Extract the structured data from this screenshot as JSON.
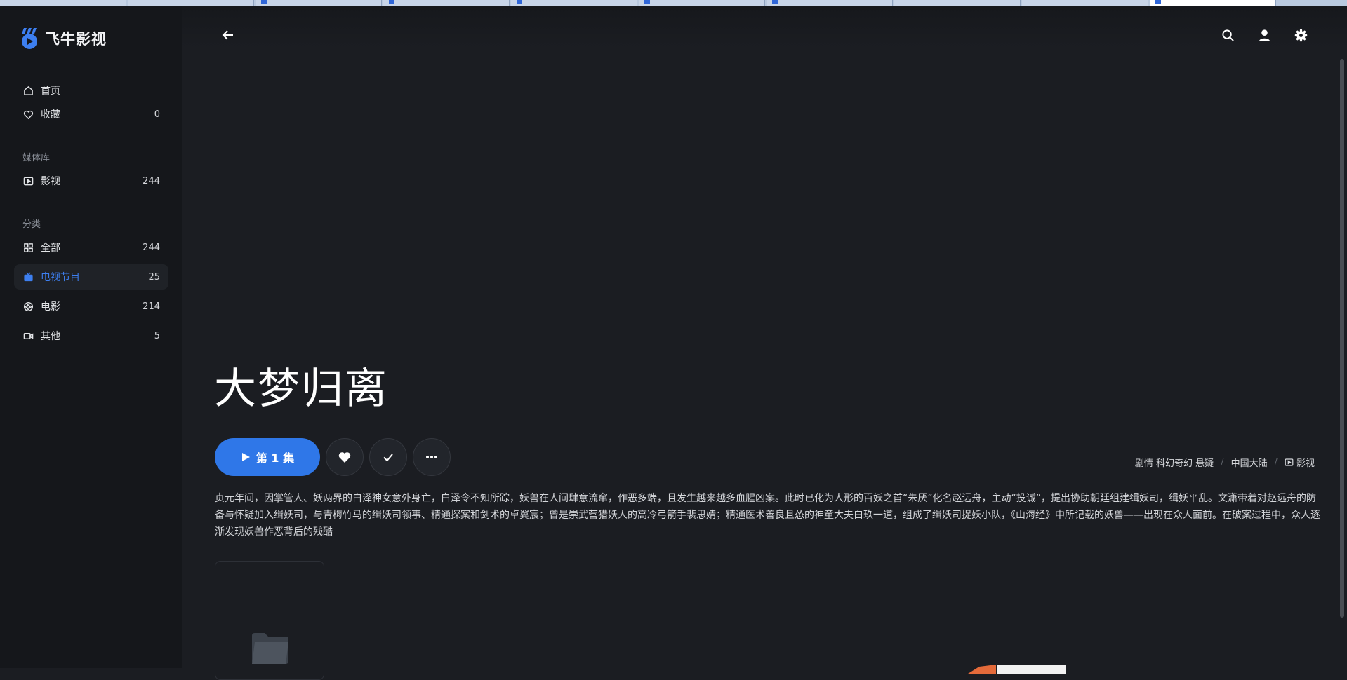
{
  "app": {
    "name": "飞牛影视",
    "accent": "#2f77e8"
  },
  "sidebar": {
    "top_items": [
      {
        "label": "首页",
        "count": "",
        "icon": "home-icon"
      },
      {
        "label": "收藏",
        "count": "0",
        "icon": "heart-icon"
      }
    ],
    "library_title": "媒体库",
    "library_items": [
      {
        "label": "影视",
        "count": "244",
        "icon": "play-square-icon"
      }
    ],
    "category_title": "分类",
    "category_items": [
      {
        "label": "全部",
        "count": "244",
        "icon": "grid-icon"
      },
      {
        "label": "电视节目",
        "count": "25",
        "icon": "tv-icon",
        "active": true
      },
      {
        "label": "电影",
        "count": "214",
        "icon": "film-reel-icon"
      },
      {
        "label": "其他",
        "count": "5",
        "icon": "video-camera-icon"
      }
    ]
  },
  "detail": {
    "title": "大梦归离",
    "play_label": "第 1 集",
    "meta": {
      "genres": "剧情 科幻奇幻 悬疑",
      "region": "中国大陆",
      "library": "影视"
    },
    "description": "贞元年间，因掌管人、妖两界的白泽神女意外身亡，白泽令不知所踪，妖兽在人间肆意流窜，作恶多端，且发生越来越多血腥凶案。此时已化为人形的百妖之首“朱厌”化名赵远舟，主动“投诚”，提出协助朝廷组建缉妖司，缉妖平乱。文潇带着对赵远舟的防备与怀疑加入缉妖司，与青梅竹马的缉妖司领事、精通探案和剑术的卓翼宸；曾是崇武营猎妖人的高冷弓箭手裴思婧；精通医术善良且怂的神童大夫白玖一道，组成了缉妖司捉妖小队，《山海经》中所记载的妖兽——出现在众人面前。在破案过程中，众人逐渐发现妖兽作恶背后的残酷"
  }
}
